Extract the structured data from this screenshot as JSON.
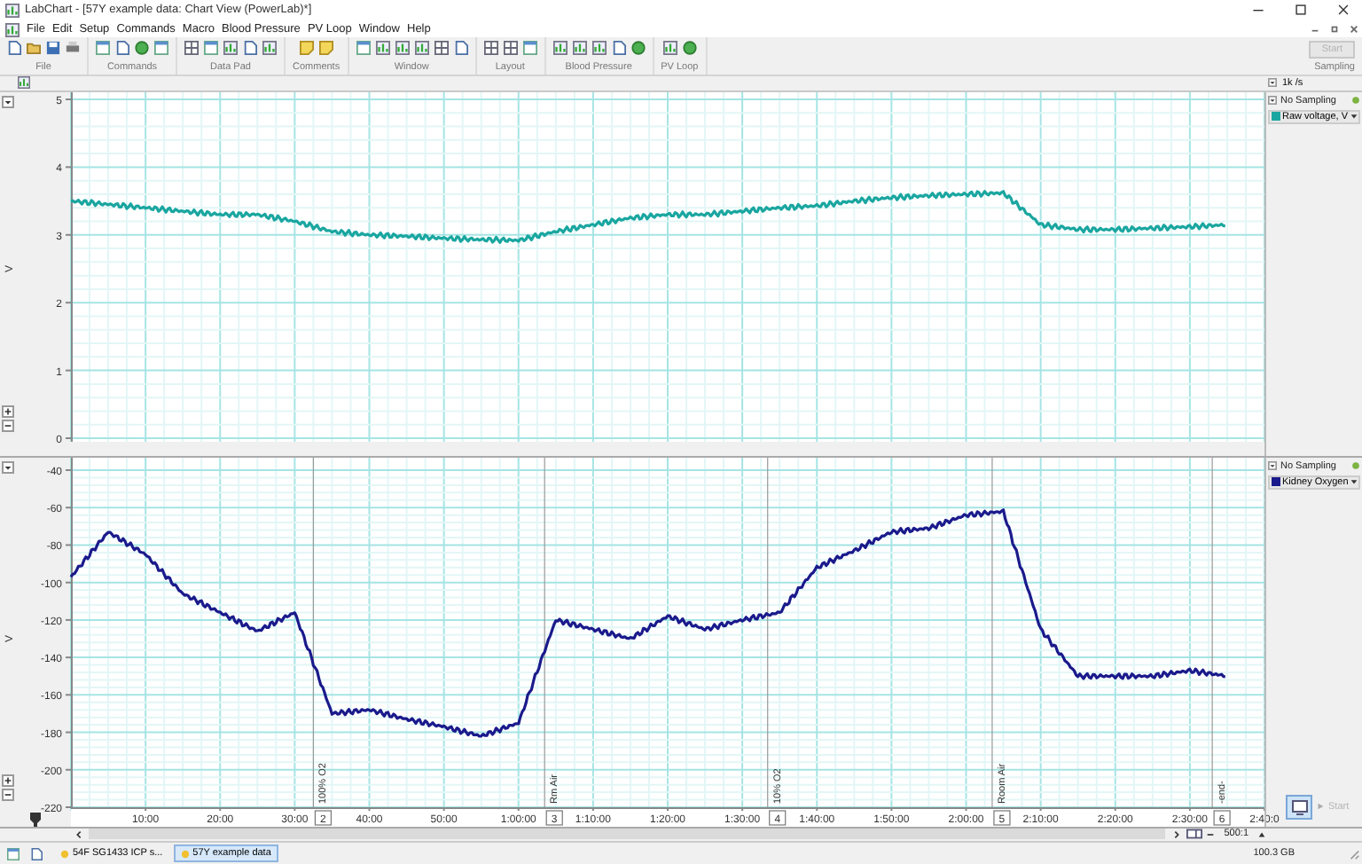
{
  "window": {
    "title": "LabChart - [57Y example data: Chart View (PowerLab)*]"
  },
  "menu": [
    "File",
    "Edit",
    "Setup",
    "Commands",
    "Macro",
    "Blood Pressure",
    "PV Loop",
    "Window",
    "Help"
  ],
  "toolbar": [
    {
      "label": "File"
    },
    {
      "label": "Commands"
    },
    {
      "label": "Data Pad"
    },
    {
      "label": "Comments"
    },
    {
      "label": "Window"
    },
    {
      "label": "Layout"
    },
    {
      "label": "Blood Pressure"
    },
    {
      "label": "PV Loop"
    }
  ],
  "sampling": {
    "label": "Sampling",
    "button": {
      "label": "Start",
      "disabled": true
    }
  },
  "rate": "1k /s",
  "channels": [
    {
      "status": "No Sampling",
      "color": "#1aa6a0",
      "chart_data": {
        "type": "line",
        "grid": true,
        "ylabel": "V",
        "x": [
          0,
          5,
          10,
          15,
          20,
          25,
          30,
          35,
          40,
          45,
          50,
          55,
          60,
          65,
          70,
          75,
          80,
          85,
          90,
          95,
          100,
          105,
          110,
          115,
          120,
          125,
          130,
          135,
          140,
          145,
          150,
          155
        ],
        "series": [
          {
            "name": "Raw voltage, V",
            "color": "#1aa6a0",
            "values": [
              3.5,
              3.45,
              3.4,
              3.35,
              3.3,
              3.3,
              3.2,
              3.05,
              3.0,
              2.98,
              2.95,
              2.93,
              2.92,
              3.05,
              3.15,
              3.25,
              3.3,
              3.3,
              3.35,
              3.4,
              3.43,
              3.5,
              3.55,
              3.58,
              3.6,
              3.62,
              3.15,
              3.08,
              3.08,
              3.1,
              3.12,
              3.15
            ]
          }
        ],
        "xlim": [
          0,
          160
        ],
        "ylim": [
          0,
          5
        ],
        "yticks": [
          0,
          1,
          2,
          3,
          4,
          5
        ]
      }
    },
    {
      "status": "No Sampling",
      "color": "#1a1a8c",
      "chart_data": {
        "type": "line",
        "grid": true,
        "ylabel": "V",
        "x": [
          0,
          5,
          10,
          15,
          20,
          25,
          30,
          35,
          40,
          45,
          50,
          55,
          60,
          65,
          70,
          75,
          80,
          85,
          90,
          95,
          100,
          105,
          110,
          115,
          120,
          125,
          130,
          135,
          140,
          145,
          150,
          155
        ],
        "series": [
          {
            "name": "Kidney Oxygen",
            "color": "#1a1a8c",
            "values": [
              -97,
              -73,
              -85,
              -106,
              -116,
              -126,
              -116,
              -170,
              -168,
              -173,
              -177,
              -182,
              -175,
              -120,
              -125,
              -130,
              -118,
              -125,
              -120,
              -116,
              -92,
              -83,
              -73,
              -71,
              -64,
              -62,
              -125,
              -150,
              -150,
              -150,
              -147,
              -150
            ]
          }
        ],
        "xlim": [
          0,
          160
        ],
        "ylim": [
          -220,
          -40
        ],
        "yticks": [
          -220,
          -200,
          -180,
          -160,
          -140,
          -120,
          -100,
          -80,
          -60,
          -40
        ],
        "xticks": [
          {
            "value": 10,
            "label": "10:00"
          },
          {
            "value": 20,
            "label": "20:00"
          },
          {
            "value": 30,
            "label": "30:00"
          },
          {
            "value": 40,
            "label": "40:00"
          },
          {
            "value": 50,
            "label": "50:00"
          },
          {
            "value": 60,
            "label": "1:00:00"
          },
          {
            "value": 70,
            "label": "1:10:00"
          },
          {
            "value": 80,
            "label": "1:20:00"
          },
          {
            "value": 90,
            "label": "1:30:00"
          },
          {
            "value": 100,
            "label": "1:40:00"
          },
          {
            "value": 110,
            "label": "1:50:00"
          },
          {
            "value": 120,
            "label": "2:00:00"
          },
          {
            "value": 130,
            "label": "2:10:00"
          },
          {
            "value": 140,
            "label": "2:20:00"
          },
          {
            "value": 150,
            "label": "2:30:00"
          },
          {
            "value": 160,
            "label": "2:40:0"
          }
        ]
      },
      "comments": [
        {
          "number": "2",
          "text": "100% O2"
        },
        {
          "number": "3",
          "text": "Rm Air"
        },
        {
          "number": "4",
          "text": "10% O2"
        },
        {
          "number": "5",
          "text": "Room Air"
        },
        {
          "number": "6",
          "text": "-end-"
        }
      ]
    }
  ],
  "bottom": {
    "zoom": "500:1",
    "start": {
      "label": "Start",
      "disabled": true
    }
  },
  "tabs": [
    {
      "label": "54F SG1433 ICP s...",
      "selected": false
    },
    {
      "label": "57Y example data",
      "selected": true
    }
  ],
  "disk": "100.3 GB"
}
